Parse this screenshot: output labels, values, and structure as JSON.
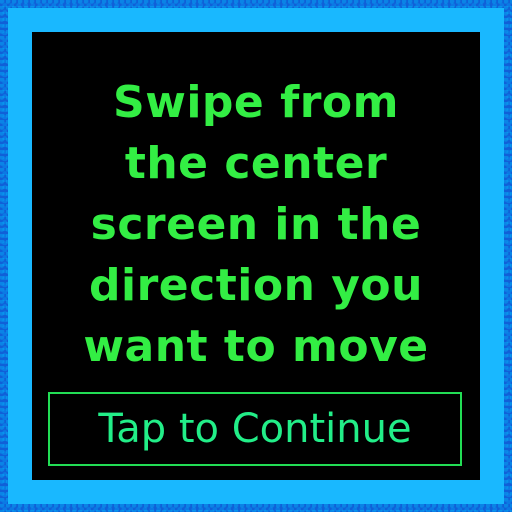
{
  "prompt": {
    "lines": [
      "Swipe from",
      "the center",
      "screen in the",
      "direction you",
      "want to move"
    ]
  },
  "continue_button": {
    "label": "Tap to Continue"
  },
  "colors": {
    "background": "#000000",
    "text": "#33ee44",
    "button_text": "#22ee88",
    "button_border": "#22dd55",
    "frame_outer": "#1060d8",
    "frame_inner": "#19b8ff"
  }
}
